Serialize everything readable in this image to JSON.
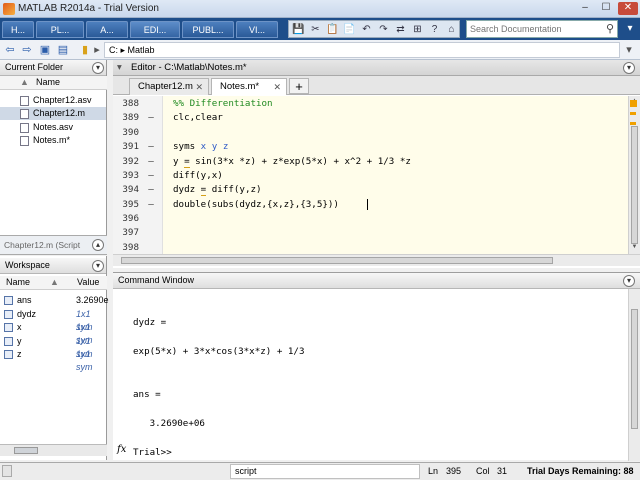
{
  "window": {
    "title": "MATLAB R2014a - Trial Version",
    "controls": [
      "–",
      "☐",
      "✕"
    ]
  },
  "ribbon": {
    "tabs": [
      "H...",
      "PL...",
      "A...",
      "EDI...",
      "PUBL...",
      "VI..."
    ],
    "search_placeholder": "Search Documentation",
    "qat_icons": [
      "💾",
      "✂",
      "📋",
      "📄",
      "↶",
      "↷",
      "⇄",
      "⊞",
      "?",
      "⌂"
    ]
  },
  "pathbar": {
    "drive": "C:",
    "separator": "▸",
    "folder": "Matlab",
    "path_text": "C:  ▸  Matlab"
  },
  "current_folder": {
    "title": "Current Folder",
    "column": "Name",
    "sort_arrow": "▲",
    "files": [
      {
        "name": "Chapter12.asv",
        "selected": false
      },
      {
        "name": "Chapter12.m",
        "selected": true
      },
      {
        "name": "Notes.asv",
        "selected": false
      },
      {
        "name": "Notes.m*",
        "selected": false
      }
    ],
    "details": "Chapter12.m (Script"
  },
  "workspace": {
    "title": "Workspace",
    "columns": [
      "Name",
      "Value"
    ],
    "sort_arrow": "▲",
    "vars": [
      {
        "name": "ans",
        "value": "3.2690e"
      },
      {
        "name": "dydz",
        "value": "1x1 sym"
      },
      {
        "name": "x",
        "value": "1x1 sym"
      },
      {
        "name": "y",
        "value": "1x1 sym"
      },
      {
        "name": "z",
        "value": "1x1 sym"
      }
    ]
  },
  "editor": {
    "title": "Editor - C:\\Matlab\\Notes.m*",
    "tabs": [
      {
        "label": "Chapter12.m",
        "active": false
      },
      {
        "label": "Notes.m*",
        "active": true
      }
    ],
    "add_tab": "+",
    "lines": [
      {
        "n": "388",
        "dash": "",
        "text": "%% Differentiation"
      },
      {
        "n": "389",
        "dash": "–",
        "text": "clc,clear"
      },
      {
        "n": "390",
        "dash": "",
        "text": ""
      },
      {
        "n": "391",
        "dash": "–",
        "text": "syms x y z"
      },
      {
        "n": "392",
        "dash": "–",
        "text": "y = sin(3*x *z) + z*exp(5*x) + x^2 + 1/3 *z"
      },
      {
        "n": "393",
        "dash": "–",
        "text": "diff(y,x)"
      },
      {
        "n": "394",
        "dash": "–",
        "text": "dydz = diff(y,z)"
      },
      {
        "n": "395",
        "dash": "–",
        "text": "double(subs(dydz,{x,z},{3,5}))"
      },
      {
        "n": "396",
        "dash": "",
        "text": ""
      },
      {
        "n": "397",
        "dash": "",
        "text": ""
      },
      {
        "n": "398",
        "dash": "",
        "text": ""
      }
    ]
  },
  "command_window": {
    "title": "Command Window",
    "output": [
      "dydz =",
      "",
      "exp(5*x) + 3*x*cos(3*x*z) + 1/3",
      "",
      "",
      "ans =",
      "",
      "   3.2690e+06",
      ""
    ],
    "fx": "fx",
    "prompt": "Trial>>"
  },
  "status": {
    "mode": "script",
    "ln_label": "Ln",
    "ln": "395",
    "col_label": "Col",
    "col": "31",
    "trial": "Trial Days Remaining: 88"
  },
  "colors": {
    "ribbon": "#1e4e8a",
    "comment": "#228b22",
    "symbol": "#2f5bc7",
    "code_bg": "#fffdea"
  }
}
